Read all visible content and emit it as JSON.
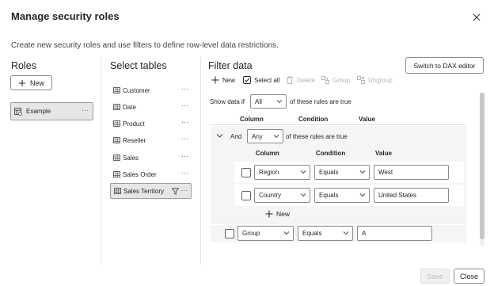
{
  "dialog": {
    "title": "Manage security roles",
    "subtitle": "Create new security roles and use filters to define row-level data restrictions.",
    "close_icon": "close-icon"
  },
  "roles": {
    "heading": "Roles",
    "new_label": "New",
    "items": [
      {
        "label": "Example",
        "more": "···"
      }
    ]
  },
  "tables": {
    "heading": "Select tables",
    "items": [
      {
        "label": "Customer",
        "more": "···"
      },
      {
        "label": "Date",
        "more": "···"
      },
      {
        "label": "Product",
        "more": "···"
      },
      {
        "label": "Reseller",
        "more": "···"
      },
      {
        "label": "Sales",
        "more": "···"
      },
      {
        "label": "Sales Order",
        "more": "···"
      },
      {
        "label": "Sales Territory",
        "more": "···",
        "selected": true
      }
    ]
  },
  "filter": {
    "heading": "Filter data",
    "dax_button": "Switch to DAX editor",
    "toolbar": {
      "new": "New",
      "select_all": "Select all",
      "delete": "Delete",
      "group": "Group",
      "ungroup": "Ungroup"
    },
    "show_data_if": "Show data if",
    "outer_quantifier": "All",
    "rules_suffix": "of these rules are true",
    "headers": {
      "column": "Column",
      "condition": "Condition",
      "value": "Value"
    },
    "group": {
      "connector": "And",
      "quantifier": "Any",
      "suffix": "of these rules are true",
      "rows": [
        {
          "column": "Region",
          "condition": "Equals",
          "value": "West"
        },
        {
          "column": "Country",
          "condition": "Equals",
          "value": "United States"
        }
      ],
      "new_label": "New"
    },
    "outer_row": {
      "column": "Group",
      "condition": "Equals",
      "value": "A"
    }
  },
  "footer": {
    "save": "Save",
    "close": "Close"
  },
  "colors": {
    "selected_bg": "#e6e6e6",
    "border": "#8a8a8a",
    "disabled_text": "#b3b3b3"
  }
}
